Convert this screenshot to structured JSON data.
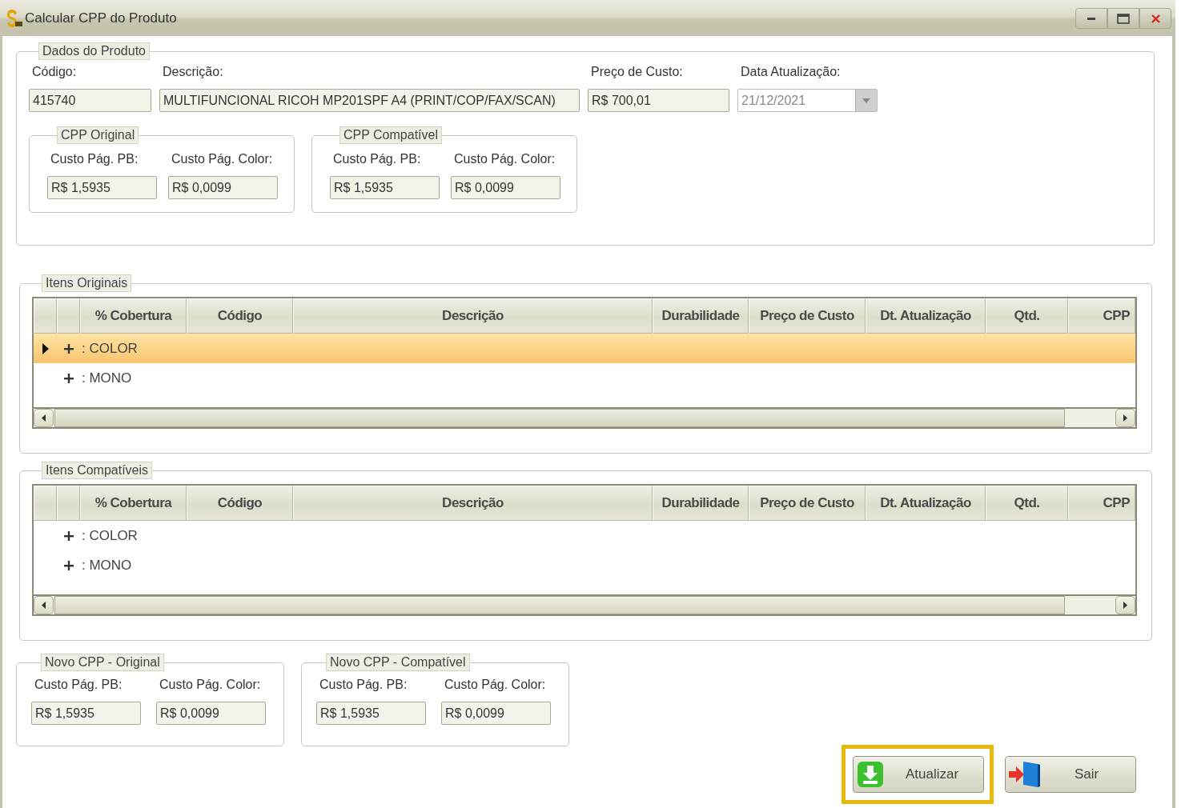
{
  "window": {
    "title": "Calcular CPP do Produto"
  },
  "product": {
    "legend": "Dados do Produto",
    "fields": [
      {
        "label": "Código:",
        "value": "415740",
        "kind": "text",
        "disabled": false
      },
      {
        "label": "Descrição:",
        "value": "MULTIFUNCIONAL RICOH MP201SPF A4 (PRINT/COP/FAX/SCAN)",
        "kind": "text",
        "disabled": false
      },
      {
        "label": "Preço de Custo:",
        "value": "R$ 700,01",
        "kind": "text",
        "disabled": false
      },
      {
        "label": "Data Atualização:",
        "value": "21/12/2021",
        "kind": "date",
        "disabled": true
      }
    ]
  },
  "cpp_groups": [
    {
      "legend": "CPP Original",
      "fields": [
        {
          "label": "Custo Pág. PB:",
          "value": "R$ 1,5935"
        },
        {
          "label": "Custo Pág. Color:",
          "value": "R$ 0,0099"
        }
      ]
    },
    {
      "legend": "CPP Compatível",
      "fields": [
        {
          "label": "Custo Pág. PB:",
          "value": "R$ 1,5935"
        },
        {
          "label": "Custo Pág. Color:",
          "value": "R$ 0,0099"
        }
      ]
    }
  ],
  "grids": [
    {
      "legend": "Itens Originais",
      "columns": [
        "% Cobertura",
        "Código",
        "Descrição",
        "Durabilidade",
        "Preço de Custo",
        "Dt. Atualização",
        "Qtd.",
        "CPP"
      ],
      "rows": [
        {
          "label": ": COLOR",
          "selected": true,
          "expanded": false
        },
        {
          "label": ": MONO",
          "selected": false,
          "expanded": false
        }
      ]
    },
    {
      "legend": "Itens Compatíveis",
      "columns": [
        "% Cobertura",
        "Código",
        "Descrição",
        "Durabilidade",
        "Preço de Custo",
        "Dt. Atualização",
        "Qtd.",
        "CPP"
      ],
      "rows": [
        {
          "label": ": COLOR",
          "selected": false,
          "expanded": false
        },
        {
          "label": ": MONO",
          "selected": false,
          "expanded": false
        }
      ]
    }
  ],
  "novo_cpp_groups": [
    {
      "legend": "Novo CPP  - Original",
      "fields": [
        {
          "label": "Custo Pág. PB:",
          "value": "R$ 1,5935"
        },
        {
          "label": "Custo Pág. Color:",
          "value": "R$ 0,0099"
        }
      ]
    },
    {
      "legend": "Novo CPP  - Compatível",
      "fields": [
        {
          "label": "Custo Pág. PB:",
          "value": "R$ 1,5935"
        },
        {
          "label": "Custo Pág. Color:",
          "value": "R$ 0,0099"
        }
      ]
    }
  ],
  "buttons": [
    {
      "label": "Atualizar",
      "kind": "download",
      "highlighted": true
    },
    {
      "label": "Sair",
      "kind": "exit",
      "highlighted": false
    }
  ]
}
